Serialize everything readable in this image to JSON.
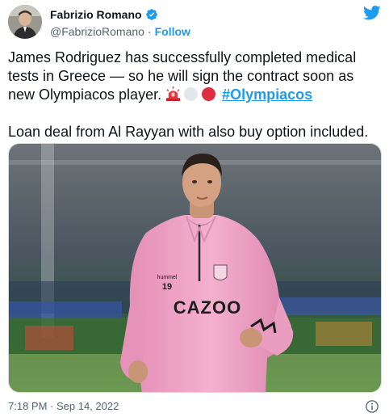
{
  "author": {
    "display_name": "Fabrizio Romano",
    "handle": "@FabrizioRomano",
    "separator": "·",
    "follow_label": "Follow",
    "verified": true
  },
  "tweet": {
    "line1": "James Rodriguez has successfully completed medical tests in Greece — so he will sign the contract soon as new Olympiacos player.",
    "emojis": [
      "siren-emoji",
      "white-circle-emoji",
      "red-circle-emoji"
    ],
    "hashtag": "#Olympiacos",
    "line2": "Loan deal from Al Rayyan with also buy option included."
  },
  "media": {
    "shirt_sponsor": "CAZOO",
    "shirt_number": "19",
    "shirt_brand": "hummel"
  },
  "footer": {
    "timestamp": "7:18 PM · Sep 14, 2022"
  },
  "colors": {
    "accent": "#1d9bf0",
    "text": "#0f1419",
    "secondary": "#536471",
    "shirt": "#f0a6c8"
  }
}
